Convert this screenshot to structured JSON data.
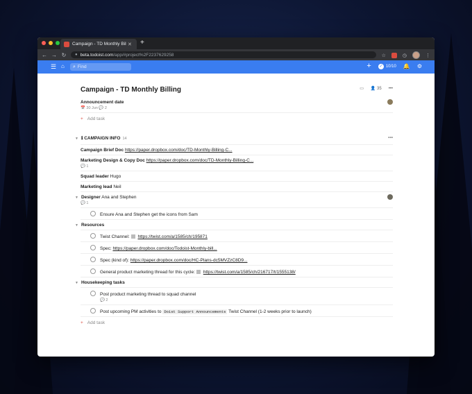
{
  "browser": {
    "tab_title": "Campaign - TD Monthly Billing",
    "url_host": "beta.todoist.com",
    "url_path": "/app/#project%2F2237629258"
  },
  "topbar": {
    "search_placeholder": "Find",
    "karma": "10/10"
  },
  "project": {
    "title": "Campaign - TD Monthly Billing",
    "members": "35",
    "announcement": {
      "name": "Announcement date",
      "date": "30 Jun",
      "comments": "2"
    },
    "add_task": "Add task"
  },
  "campaign_info": {
    "header": "CAMPAIGN INFO",
    "count": "14",
    "items": [
      {
        "label": "Campaign Brief Doc",
        "link": "https://paper.dropbox.com/doc/TD-Monthly-Billing-C..."
      },
      {
        "label": "Marketing Design & Copy Doc",
        "link": "https://paper.dropbox.com/doc/TD-Monthly-Billing-C...",
        "comments": "1"
      },
      {
        "label": "Squad leader",
        "value": "Hugo"
      },
      {
        "label": "Marketing lead",
        "value": "Neil"
      },
      {
        "label": "Designer",
        "value": "Ana and Stephen",
        "comments": "1"
      }
    ],
    "designer_sub": "Ensure Ana and Stephen get the icons from Sam",
    "resources_label": "Resources",
    "resources": [
      {
        "prefix": "Twist Channel:",
        "link": "https://twist.com/a/1585/ch/195871"
      },
      {
        "prefix": "Spec:",
        "link": "https://paper.dropbox.com/doc/Todoist-Monthly-bill..."
      },
      {
        "prefix": "Spec (kind of):",
        "link": "https://paper.dropbox.com/doc/HC-Plans-dc5MVZzC8D9..."
      },
      {
        "prefix": "General product marketing thread for this cycle:",
        "link": "https://twist.com/a/1585/ch/216717/t/1555138/"
      }
    ],
    "housekeeping_label": "Housekeeping tasks",
    "housekeeping": [
      {
        "text": "Post product marketing thread to squad channel",
        "comments": "2"
      },
      {
        "text_a": "Post upcoming PM activities to",
        "code": "Doist Support Announcements",
        "text_b": "Twist Channel (1-2 weeks prior to launch)"
      }
    ],
    "add_task": "Add task"
  }
}
